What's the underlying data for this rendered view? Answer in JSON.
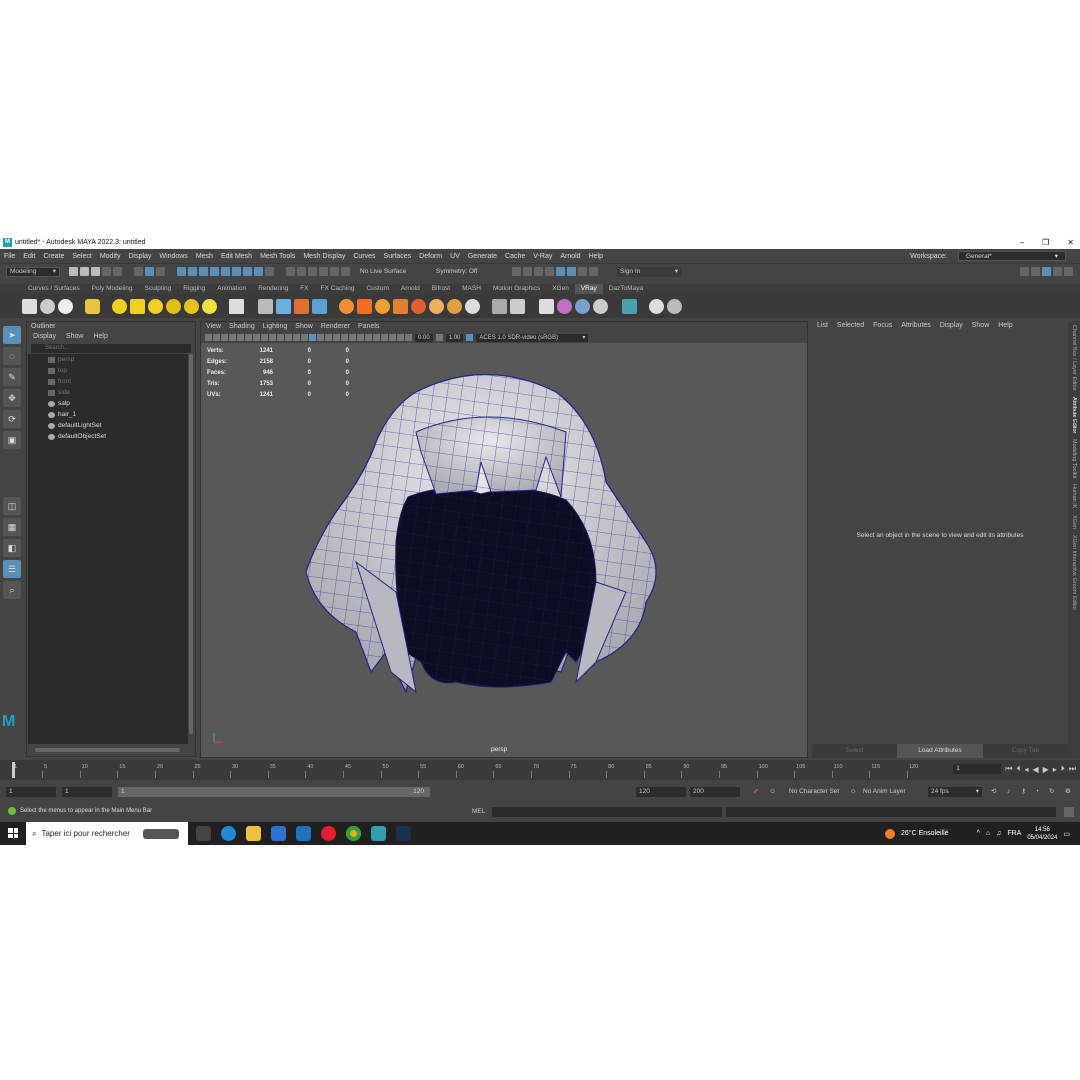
{
  "window": {
    "title": "untitled* - Autodesk MAYA 2022.3: untitled",
    "logo_letter": "M",
    "minimize": "–",
    "restore": "❐",
    "close": "✕"
  },
  "menubar": {
    "items": [
      "File",
      "Edit",
      "Create",
      "Select",
      "Modify",
      "Display",
      "Windows",
      "Mesh",
      "Edit Mesh",
      "Mesh Tools",
      "Mesh Display",
      "Curves",
      "Surfaces",
      "Deform",
      "UV",
      "Generate",
      "Cache",
      "V-Ray",
      "Arnold",
      "Help"
    ],
    "workspace_label": "Workspace:",
    "workspace_value": "General*"
  },
  "statusline": {
    "menuset": "Modeling",
    "live_surface": "No Live Surface",
    "symmetry": "Symmetry: Off",
    "sign_in": "Sign In"
  },
  "shelf": {
    "tabs": [
      "Curves / Surfaces",
      "Poly Modeling",
      "Sculpting",
      "Rigging",
      "Animation",
      "Rendering",
      "FX",
      "FX Caching",
      "Custom",
      "Arnold",
      "Bifrost",
      "MASH",
      "Motion Graphics",
      "XGen",
      "VRay",
      "DazToMaya"
    ],
    "active_tab": "VRay"
  },
  "outliner": {
    "title": "Outliner",
    "menu": [
      "Display",
      "Show",
      "Help"
    ],
    "search_placeholder": "Search...",
    "items": [
      {
        "name": "persp",
        "type": "camera",
        "dim": true
      },
      {
        "name": "top",
        "type": "camera",
        "dim": true
      },
      {
        "name": "front",
        "type": "camera",
        "dim": true
      },
      {
        "name": "side",
        "type": "camera",
        "dim": true
      },
      {
        "name": "salp",
        "type": "mesh",
        "dim": false
      },
      {
        "name": "hair_1",
        "type": "mesh",
        "dim": false
      },
      {
        "name": "defaultLightSet",
        "type": "set",
        "dim": false
      },
      {
        "name": "defaultObjectSet",
        "type": "set",
        "dim": false
      }
    ]
  },
  "viewport": {
    "menu": [
      "View",
      "Shading",
      "Lighting",
      "Show",
      "Renderer",
      "Panels"
    ],
    "exposure": "0.00",
    "gamma": "1.00",
    "color_space": "ACES 1.0 SDR-video (sRGB)",
    "camera_label": "persp",
    "hud": [
      {
        "label": "Verts:",
        "v": "1241",
        "a": "0",
        "b": "0"
      },
      {
        "label": "Edges:",
        "v": "2158",
        "a": "0",
        "b": "0"
      },
      {
        "label": "Faces:",
        "v": "946",
        "a": "0",
        "b": "0"
      },
      {
        "label": "Tris:",
        "v": "1753",
        "a": "0",
        "b": "0"
      },
      {
        "label": "UVs:",
        "v": "1241",
        "a": "0",
        "b": "0"
      }
    ]
  },
  "attribute_editor": {
    "menu": [
      "List",
      "Selected",
      "Focus",
      "Attributes",
      "Display",
      "Show",
      "Help"
    ],
    "message": "Select an object in the scene to view and edit its attributes",
    "buttons": [
      "Select",
      "Load Attributes",
      "Copy Tab"
    ]
  },
  "side_tabs": [
    "Channel Box / Layer Editor",
    "Attribute Editor",
    "Modeling Toolkit",
    "Human IK",
    "XGen",
    "XGen Interactive Groom Editor"
  ],
  "timeslider": {
    "ticks": [
      "1",
      "5",
      "10",
      "15",
      "20",
      "25",
      "30",
      "35",
      "40",
      "45",
      "50",
      "55",
      "60",
      "65",
      "70",
      "75",
      "80",
      "85",
      "90",
      "95",
      "100",
      "105",
      "110",
      "115",
      "120"
    ],
    "current_frame": "1"
  },
  "range": {
    "start": "1",
    "playback_start": "1",
    "slider_start": "1",
    "slider_end": "120",
    "playback_end": "120",
    "end": "200",
    "character_set": "No Character Set",
    "anim_layer": "No Anim Layer",
    "fps": "24 fps"
  },
  "commandline": {
    "help": "Select the menus to appear in the Main Menu Bar",
    "mel": "MEL"
  },
  "taskbar": {
    "search": "Taper ici pour rechercher",
    "weather": "26°C  Ensoleillé",
    "lang": "FRA",
    "time": "14:56",
    "date": "05/04/2024"
  }
}
